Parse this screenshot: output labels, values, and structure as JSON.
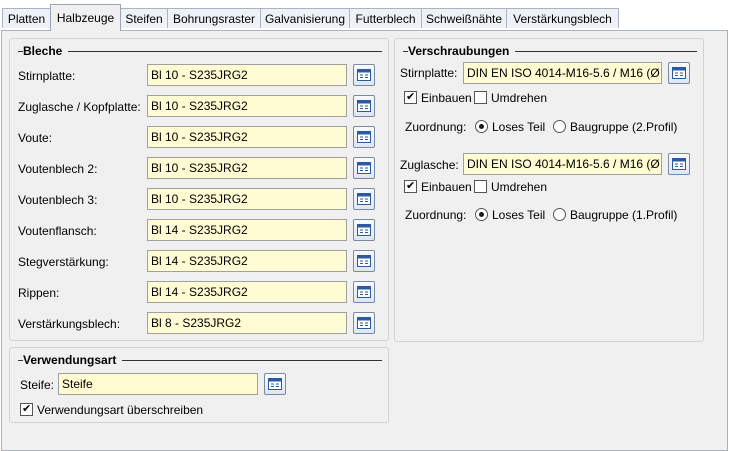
{
  "tabs": [
    "Platten",
    "Halbzeuge",
    "Steifen",
    "Bohrungsraster",
    "Galvanisierung",
    "Futterblech",
    "Schweißnähte",
    "Verstärkungsblech"
  ],
  "bleche": {
    "title": "Bleche",
    "rows": [
      {
        "label": "Stirnplatte:",
        "value": "Bl 10 - S235JRG2"
      },
      {
        "label": "Zuglasche / Kopfplatte:",
        "value": "Bl 10 - S235JRG2"
      },
      {
        "label": "Voute:",
        "value": "Bl 10 - S235JRG2"
      },
      {
        "label": "Voutenblech 2:",
        "value": "Bl 10 - S235JRG2"
      },
      {
        "label": "Voutenblech 3:",
        "value": "Bl 10 - S235JRG2"
      },
      {
        "label": "Voutenflansch:",
        "value": "Bl 14 - S235JRG2"
      },
      {
        "label": "Stegverstärkung:",
        "value": "Bl 14 - S235JRG2"
      },
      {
        "label": "Rippen:",
        "value": "Bl 14 - S235JRG2"
      },
      {
        "label": "Verstärkungsblech:",
        "value": "Bl 8 - S235JRG2"
      }
    ]
  },
  "verwendungsart": {
    "title": "Verwendungsart",
    "steife_label": "Steife:",
    "steife_value": "Steife",
    "override_label": "Verwendungsart überschreiben"
  },
  "verschraubungen": {
    "title": "Verschraubungen",
    "einbauen": "Einbauen",
    "umdrehen": "Umdrehen",
    "zuordnung": "Zuordnung:",
    "loses_teil": "Loses Teil",
    "stirnplatte_label": "Stirnplatte:",
    "stirnplatte_value": "DIN EN ISO 4014-M16-5.6 / M16 (Ø",
    "stirnplatte_baugruppe": "Baugruppe (2.Profil)",
    "zuglasche_label": "Zuglasche:",
    "zuglasche_value": "DIN EN ISO 4014-M16-5.6 / M16 (Ø",
    "zuglasche_baugruppe": "Baugruppe (1.Profil)"
  }
}
